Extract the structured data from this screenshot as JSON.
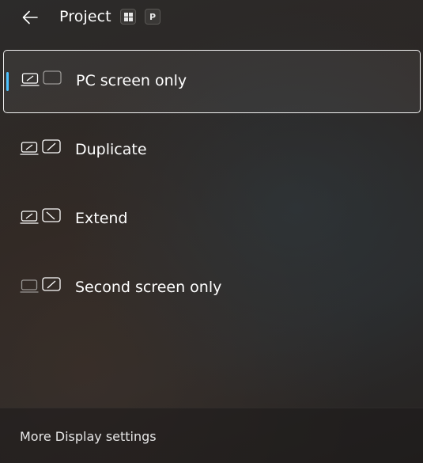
{
  "header": {
    "back_icon": "back-arrow-icon",
    "title": "Project",
    "shortcut": {
      "key_1_icon": "windows-logo-icon",
      "key_2": "P"
    }
  },
  "options": [
    {
      "label": "PC screen only",
      "icon": "pc-screen-only-icon",
      "selected": true
    },
    {
      "label": "Duplicate",
      "icon": "duplicate-icon",
      "selected": false
    },
    {
      "label": "Extend",
      "icon": "extend-icon",
      "selected": false
    },
    {
      "label": "Second screen only",
      "icon": "second-screen-only-icon",
      "selected": false
    }
  ],
  "footer": {
    "link": "More Display settings"
  },
  "colors": {
    "accent": "#4cc2ff",
    "text": "#ffffff",
    "selected_border": "#f2f2f2"
  }
}
